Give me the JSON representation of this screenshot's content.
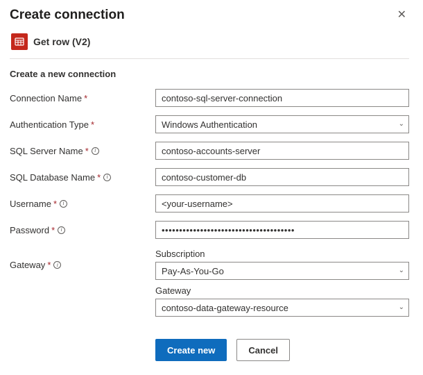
{
  "dialog": {
    "title": "Create connection",
    "action_label": "Get row (V2)",
    "subtitle": "Create a new connection"
  },
  "fields": {
    "connection_name": {
      "label": "Connection Name",
      "required": true,
      "info": false,
      "value": "contoso-sql-server-connection"
    },
    "auth_type": {
      "label": "Authentication Type",
      "required": true,
      "info": false,
      "value": "Windows Authentication"
    },
    "server_name": {
      "label": "SQL Server Name",
      "required": true,
      "info": true,
      "value": "contoso-accounts-server"
    },
    "database_name": {
      "label": "SQL Database Name",
      "required": true,
      "info": true,
      "value": "contoso-customer-db"
    },
    "username": {
      "label": "Username",
      "required": true,
      "info": true,
      "value": "<your-username>"
    },
    "password": {
      "label": "Password",
      "required": true,
      "info": true,
      "value": "••••••••••••••••••••••••••••••••••••••"
    },
    "gateway": {
      "label": "Gateway",
      "required": true,
      "info": true
    }
  },
  "gateway": {
    "subscription_label": "Subscription",
    "subscription_value": "Pay-As-You-Go",
    "gateway_label": "Gateway",
    "gateway_value": "contoso-data-gateway-resource"
  },
  "buttons": {
    "create": "Create new",
    "cancel": "Cancel"
  },
  "glyphs": {
    "required": "*",
    "chevron": "⌄",
    "close": "✕",
    "info": "i"
  }
}
